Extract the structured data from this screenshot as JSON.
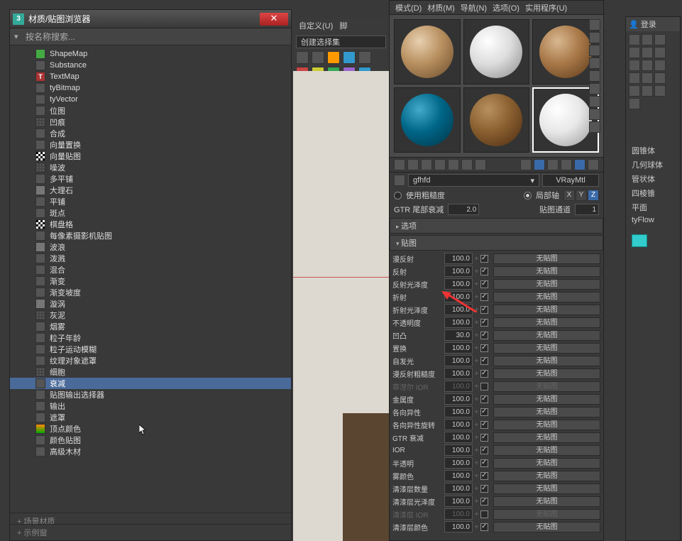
{
  "browser": {
    "title": "材质/贴图浏览器",
    "search_placeholder": "按名称搜索...",
    "items": [
      {
        "label": "ShapeMap",
        "ic": "green"
      },
      {
        "label": "Substance",
        "ic": ""
      },
      {
        "label": "TextMap",
        "ic": "red"
      },
      {
        "label": "tyBitmap",
        "ic": ""
      },
      {
        "label": "tyVector",
        "ic": ""
      },
      {
        "label": "位图",
        "ic": ""
      },
      {
        "label": "凹痕",
        "ic": "noise"
      },
      {
        "label": "合成",
        "ic": ""
      },
      {
        "label": "向量置换",
        "ic": ""
      },
      {
        "label": "向量贴图",
        "ic": "chk"
      },
      {
        "label": "噪波",
        "ic": "noise"
      },
      {
        "label": "多平铺",
        "ic": ""
      },
      {
        "label": "大理石",
        "ic": "wave"
      },
      {
        "label": "平铺",
        "ic": ""
      },
      {
        "label": "斑点",
        "ic": ""
      },
      {
        "label": "棋盘格",
        "ic": "chk"
      },
      {
        "label": "每像素摄影机贴图",
        "ic": ""
      },
      {
        "label": "波浪",
        "ic": "wave"
      },
      {
        "label": "泼溅",
        "ic": ""
      },
      {
        "label": "混合",
        "ic": ""
      },
      {
        "label": "渐变",
        "ic": ""
      },
      {
        "label": "渐变坡度",
        "ic": ""
      },
      {
        "label": "漩涡",
        "ic": "wave"
      },
      {
        "label": "灰泥",
        "ic": "noise"
      },
      {
        "label": "烟雾",
        "ic": ""
      },
      {
        "label": "粒子年龄",
        "ic": ""
      },
      {
        "label": "粒子运动模糊",
        "ic": ""
      },
      {
        "label": "纹理对象遮罩",
        "ic": ""
      },
      {
        "label": "细胞",
        "ic": "noise"
      },
      {
        "label": "衰减",
        "ic": "",
        "sel": true
      },
      {
        "label": "贴图输出选择器",
        "ic": ""
      },
      {
        "label": "输出",
        "ic": ""
      },
      {
        "label": "遮罩",
        "ic": ""
      },
      {
        "label": "顶点颜色",
        "ic": "grad"
      },
      {
        "label": "颜色贴图",
        "ic": ""
      },
      {
        "label": "高级木材",
        "ic": ""
      }
    ],
    "footer1": "+ 场景材质",
    "footer2": "+ 示例窗"
  },
  "bg": {
    "menu1": "自定义(U)",
    "menu2": "脚",
    "sel_label": "创建选择集"
  },
  "me": {
    "menu": [
      "模式(D)",
      "材质(M)",
      "导航(N)",
      "选项(O)",
      "实用程序(U)"
    ],
    "mat_name": "gfhfd",
    "mat_type": "VRayMtl",
    "rough_label": "使用粗糙度",
    "local_label": "局部轴",
    "gtr_label": "GTR 尾部衰减",
    "gtr_val": "2.0",
    "chan_label": "贴图通道",
    "chan_val": "1",
    "roll_opt": "选项",
    "roll_maps": "贴图",
    "no_map": "无贴图",
    "maps": [
      {
        "lbl": "漫反射",
        "v": "100.0",
        "on": true
      },
      {
        "lbl": "反射",
        "v": "100.0",
        "on": true
      },
      {
        "lbl": "反射光泽度",
        "v": "100.0",
        "on": true
      },
      {
        "lbl": "折射",
        "v": "100.0",
        "on": true
      },
      {
        "lbl": "折射光泽度",
        "v": "100.0",
        "on": true
      },
      {
        "lbl": "不透明度",
        "v": "100.0",
        "on": true
      },
      {
        "lbl": "凹凸",
        "v": "30.0",
        "on": true
      },
      {
        "lbl": "置换",
        "v": "100.0",
        "on": true
      },
      {
        "lbl": "自发光",
        "v": "100.0",
        "on": true
      },
      {
        "lbl": "漫反射粗糙度",
        "v": "100.0",
        "on": true
      },
      {
        "lbl": "菲涅尔 IOR",
        "v": "100.0",
        "on": false,
        "dim": true
      },
      {
        "lbl": "金属度",
        "v": "100.0",
        "on": true
      },
      {
        "lbl": "各向异性",
        "v": "100.0",
        "on": true
      },
      {
        "lbl": "各向异性旋转",
        "v": "100.0",
        "on": true
      },
      {
        "lbl": "GTR 衰减",
        "v": "100.0",
        "on": true
      },
      {
        "lbl": "IOR",
        "v": "100.0",
        "on": true
      },
      {
        "lbl": "半透明",
        "v": "100.0",
        "on": true
      },
      {
        "lbl": "雾颜色",
        "v": "100.0",
        "on": true
      },
      {
        "lbl": "清漆层数量",
        "v": "100.0",
        "on": true
      },
      {
        "lbl": "清漆层光泽度",
        "v": "100.0",
        "on": true
      },
      {
        "lbl": "清漆层 IOR",
        "v": "100.0",
        "on": false,
        "dim": true
      },
      {
        "lbl": "清漆层颜色",
        "v": "100.0",
        "on": true
      }
    ]
  },
  "rp": {
    "login": "登录",
    "items": [
      "圆锥体",
      "几何球体",
      "管状体",
      "四棱锥",
      "平面",
      "tyFlow"
    ]
  }
}
